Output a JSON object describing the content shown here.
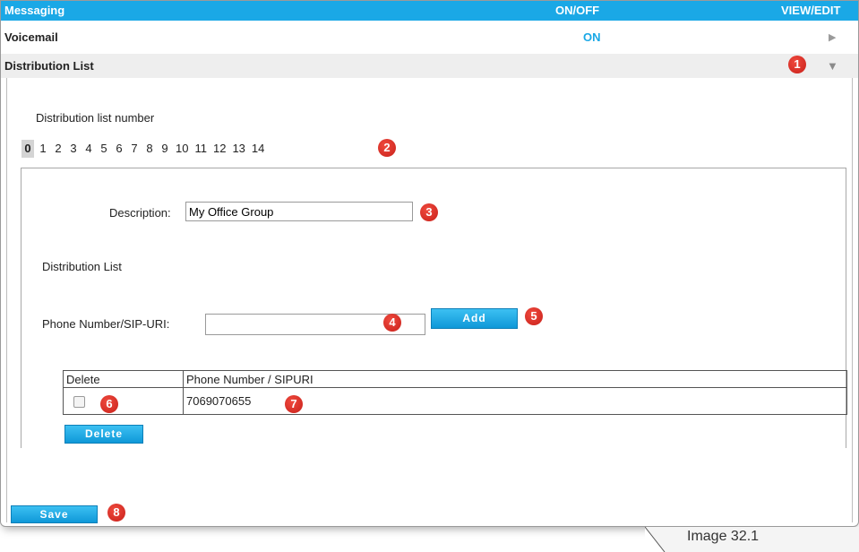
{
  "header": {
    "col_messaging": "Messaging",
    "col_onoff": "ON/OFF",
    "col_viewedit": "VIEW/EDIT"
  },
  "voicemail": {
    "label": "Voicemail",
    "status": "ON",
    "expand_icon": "play-right-icon"
  },
  "distribution_list_row": {
    "label": "Distribution List",
    "collapse_icon": "triangle-down-icon"
  },
  "dl_number": {
    "label": "Distribution list number",
    "numbers": [
      "0",
      "1",
      "2",
      "3",
      "4",
      "5",
      "6",
      "7",
      "8",
      "9",
      "10",
      "11",
      "12",
      "13",
      "14"
    ],
    "selected": "0"
  },
  "description": {
    "label": "Description:",
    "value": "My Office Group"
  },
  "distribution_list_label": "Distribution List",
  "phone": {
    "label": "Phone Number/SIP-URI:",
    "value": "",
    "placeholder": ""
  },
  "buttons": {
    "add": "Add",
    "delete": "Delete",
    "save": "Save"
  },
  "table": {
    "headers": [
      "Delete",
      "Phone Number / SIPURI"
    ],
    "rows": [
      {
        "checked": false,
        "number": "7069070655"
      }
    ]
  },
  "badges": [
    "1",
    "2",
    "3",
    "4",
    "5",
    "6",
    "7",
    "8"
  ],
  "caption": "Image 32.1",
  "colors": {
    "accent": "#1aa8e6",
    "badge": "#d42b22"
  }
}
